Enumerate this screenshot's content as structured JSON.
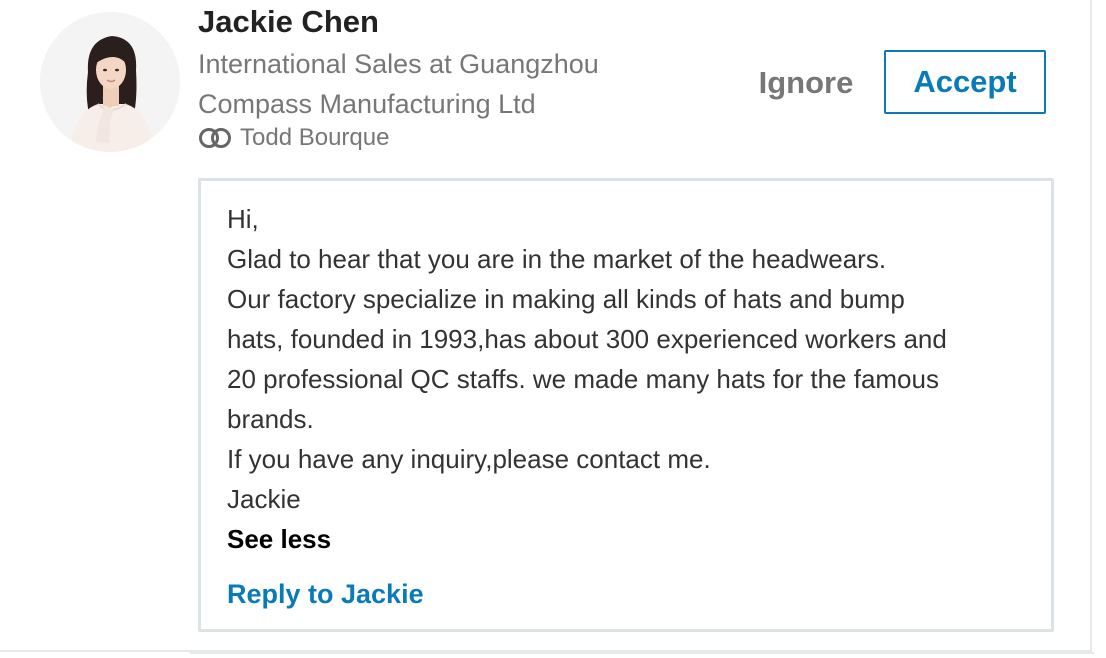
{
  "invitation": {
    "name": "Jackie Chen",
    "headline": "International Sales at Guangzhou Compass Manufacturing Ltd",
    "mutual_connection": {
      "icon": "mutual-connections-icon",
      "name": "Todd Bourque"
    },
    "actions": {
      "ignore_label": "Ignore",
      "accept_label": "Accept"
    }
  },
  "message": {
    "lines": [
      "Hi,",
      "Glad to hear that you are in the market of the headwears.",
      "Our factory specialize in making all kinds of hats and bump",
      "hats, founded in 1993,has about 300 experienced workers and",
      "20 professional QC staffs. we made many hats for the famous",
      "brands.",
      "If you have any inquiry,please contact me.",
      "Jackie"
    ],
    "see_less_label": "See less",
    "reply_label": "Reply to Jackie"
  },
  "colors": {
    "accent": "#0a7bb8",
    "muted_text": "#777777",
    "border": "#dde2e6"
  }
}
